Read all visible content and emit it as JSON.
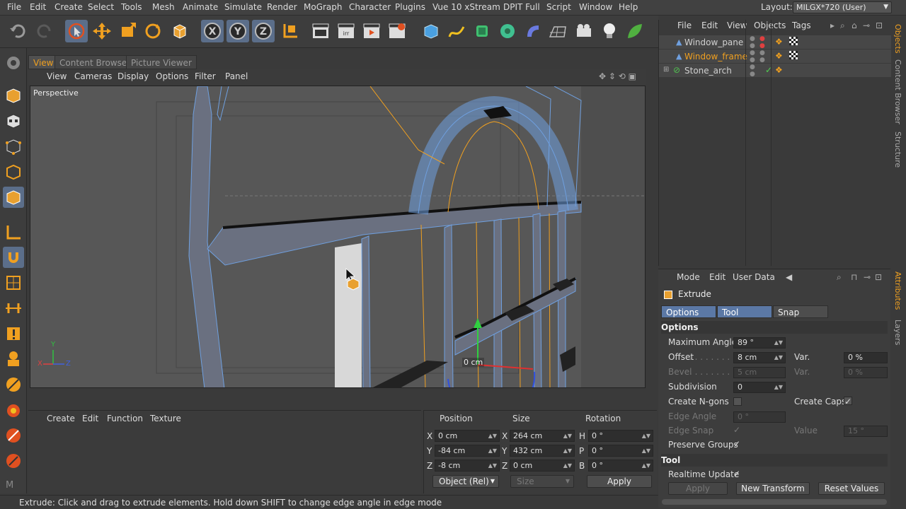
{
  "menubar": {
    "items": [
      "File",
      "Edit",
      "Create",
      "Select",
      "Tools",
      "Mesh",
      "Animate",
      "Simulate",
      "Render",
      "MoGraph",
      "Character",
      "Plugins",
      "Vue 10 xStream",
      "DPIT Full",
      "Script",
      "Window",
      "Help"
    ],
    "layout_label": "Layout:",
    "layout_value": "MILGX*720 (User)"
  },
  "view_tabs": [
    "View",
    "Content Browser",
    "Picture Viewer"
  ],
  "view_menu": [
    "View",
    "Cameras",
    "Display",
    "Options",
    "Filter",
    "Panel"
  ],
  "viewport": {
    "label": "Perspective",
    "hud_value": "0 cm",
    "axis_y": "Y",
    "axis_x": "X",
    "axis_z": "Z"
  },
  "object_manager": {
    "menu": [
      "File",
      "Edit",
      "View",
      "Objects",
      "Tags"
    ],
    "objects": [
      {
        "name": "Window_pane",
        "color": "#dcdcdc"
      },
      {
        "name": "Window_frame",
        "color": "#f0a020"
      },
      {
        "name": "Stone_arch",
        "color": "#dcdcdc"
      }
    ]
  },
  "side_tabs": [
    "Objects",
    "Content Browser",
    "Structure",
    "Attributes",
    "Layers"
  ],
  "attributes": {
    "menu": [
      "Mode",
      "Edit",
      "User Data"
    ],
    "tool_name": "Extrude",
    "tabs": [
      "Options",
      "Tool",
      "Snap Settings"
    ],
    "options_header": "Options",
    "tool_header": "Tool",
    "max_angle_label": "Maximum Angle",
    "max_angle_value": "89 °",
    "offset_label": "Offset",
    "offset_value": "8 cm",
    "var_label": "Var.",
    "var_value1": "0 %",
    "bevel_label": "Bevel",
    "bevel_value": "5 cm",
    "var_value2": "0 %",
    "subdivision_label": "Subdivision",
    "subdivision_value": "0",
    "create_ngons_label": "Create N-gons",
    "create_caps_label": "Create Caps",
    "edge_angle_label": "Edge Angle",
    "edge_angle_value": "0 °",
    "edge_snap_label": "Edge Snap",
    "value_label": "Value",
    "value_value": "15 °",
    "preserve_groups_label": "Preserve Groups",
    "realtime_update_label": "Realtime Update",
    "apply_button": "Apply",
    "new_transform_button": "New Transform",
    "reset_values_button": "Reset Values",
    "checkmark": "✓"
  },
  "material_menu": [
    "Create",
    "Edit",
    "Function",
    "Texture"
  ],
  "coordinates": {
    "headers": [
      "Position",
      "Size",
      "Rotation"
    ],
    "rows": [
      {
        "pos_label": "X",
        "pos": "0 cm",
        "size_label": "X",
        "size": "264 cm",
        "rot_label": "H",
        "rot": "0 °"
      },
      {
        "pos_label": "Y",
        "pos": "-84 cm",
        "size_label": "Y",
        "size": "432 cm",
        "rot_label": "P",
        "rot": "0 °"
      },
      {
        "pos_label": "Z",
        "pos": "-8 cm",
        "size_label": "Z",
        "size": "0 cm",
        "rot_label": "B",
        "rot": "0 °"
      }
    ],
    "mode_select": "Object (Rel)",
    "size_select": "Size",
    "apply_button": "Apply"
  },
  "status": "Extrude: Click and drag to extrude elements. Hold down SHIFT to change edge angle in edge mode",
  "colors": {
    "accent": "#f0a020",
    "selected_tab": "#5b78a5",
    "wire": "#6fa0e0"
  }
}
